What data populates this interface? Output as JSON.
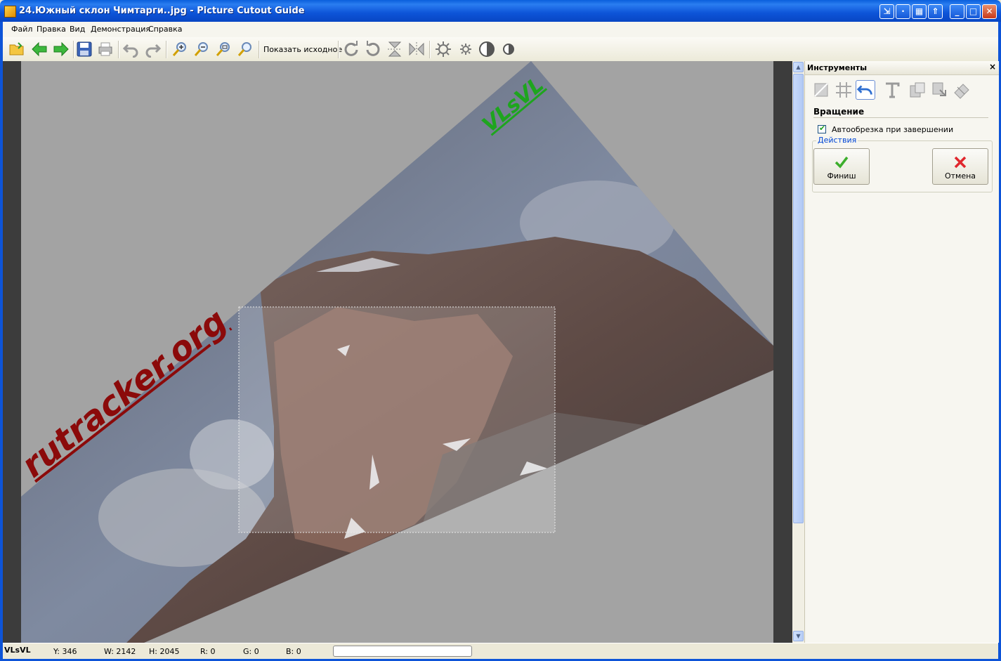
{
  "window": {
    "title": "24.Южный склон Чимтарги..jpg - Picture Cutout Guide"
  },
  "menu": {
    "items": [
      "Файл",
      "Правка",
      "Вид",
      "Демонстрация",
      "Справка"
    ]
  },
  "toolbar": {
    "show_original_label": "Показать исходное",
    "icons": [
      "open-icon",
      "back-arrow-icon",
      "forward-arrow-icon",
      "save-icon",
      "print-icon",
      "undo-icon",
      "redo-icon",
      "zoom-in-icon",
      "zoom-out-icon",
      "zoom-fit-icon",
      "zoom-actual-icon",
      "rotate-cw-icon",
      "rotate-ccw-icon",
      "flip-vertical-icon",
      "flip-horizontal-icon",
      "brightness-icon",
      "brightness-small-icon",
      "contrast-icon",
      "contrast-small-icon"
    ]
  },
  "canvas": {
    "watermark_main": "rutracker.org",
    "watermark_corner": "VLsVL"
  },
  "panel": {
    "title": "Инструменты",
    "close_label": "×",
    "section_title": "Вращение",
    "autocrop_label": "Автообрезка при завершении",
    "autocrop_checked": true,
    "actions_label": "Действия",
    "finish_label": "Финиш",
    "cancel_label": "Отмена"
  },
  "status": {
    "logo": "VLsVL",
    "y": "Y: 346",
    "w": "W: 2142",
    "h": "H: 2045",
    "r": "R: 0",
    "g": "G: 0",
    "b": "B: 0"
  },
  "colors": {
    "titlebar": "#0d54d8",
    "accent_green": "#1ea51e",
    "cancel_red": "#e0262d",
    "watermark_red": "#8b0a0a"
  }
}
